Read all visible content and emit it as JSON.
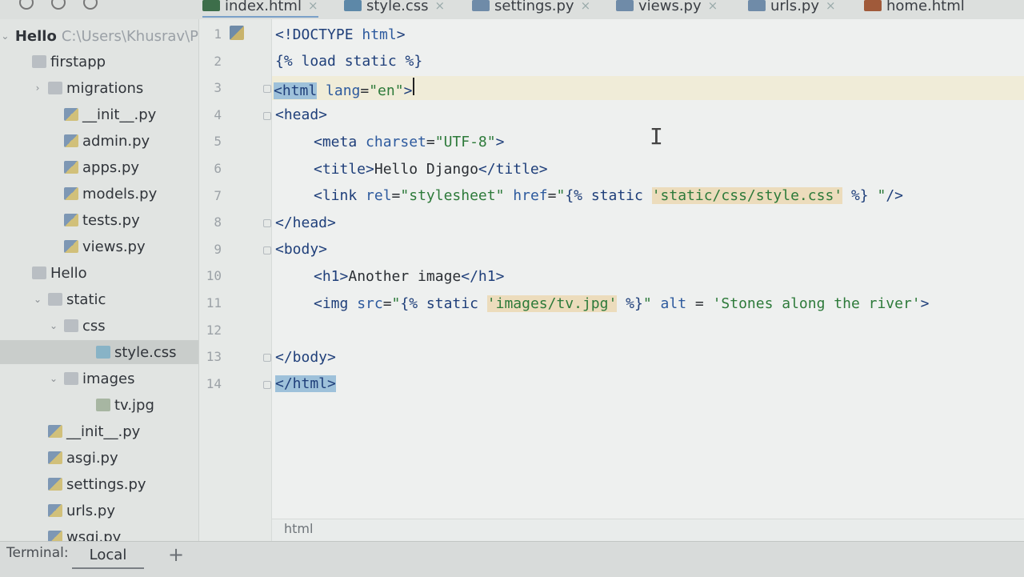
{
  "tabs": [
    {
      "label": "index.html",
      "icon": "html-file-icon",
      "color": "#3d6e4a",
      "active": true
    },
    {
      "label": "style.css",
      "icon": "css-file-icon",
      "color": "#5d88a8",
      "active": false
    },
    {
      "label": "settings.py",
      "icon": "python-file-icon",
      "color": "#6f8ba8",
      "active": false
    },
    {
      "label": "views.py",
      "icon": "python-file-icon",
      "color": "#6f8ba8",
      "active": false
    },
    {
      "label": "urls.py",
      "icon": "python-file-icon",
      "color": "#6f8ba8",
      "active": false
    },
    {
      "label": "home.html",
      "icon": "html-file-icon",
      "color": "#a05a3a",
      "active": false
    }
  ],
  "tab_close_glyph": "×",
  "sidebar": {
    "root": {
      "name": "Hello",
      "path": "C:\\Users\\Khusrav\\P"
    },
    "items": [
      {
        "label": "firstapp",
        "type": "folder",
        "icon": "folder-icon",
        "depth": 1,
        "arrow": ""
      },
      {
        "label": "migrations",
        "type": "folder",
        "icon": "folder-icon",
        "depth": 2,
        "arrow": "›"
      },
      {
        "label": "__init__.py",
        "type": "py",
        "icon": "python-file-icon",
        "depth": 3,
        "arrow": ""
      },
      {
        "label": "admin.py",
        "type": "py",
        "icon": "python-file-icon",
        "depth": 3,
        "arrow": ""
      },
      {
        "label": "apps.py",
        "type": "py",
        "icon": "python-file-icon",
        "depth": 3,
        "arrow": ""
      },
      {
        "label": "models.py",
        "type": "py",
        "icon": "python-file-icon",
        "depth": 3,
        "arrow": ""
      },
      {
        "label": "tests.py",
        "type": "py",
        "icon": "python-file-icon",
        "depth": 3,
        "arrow": ""
      },
      {
        "label": "views.py",
        "type": "py",
        "icon": "python-file-icon",
        "depth": 3,
        "arrow": ""
      },
      {
        "label": "Hello",
        "type": "folder",
        "icon": "folder-icon",
        "depth": 1,
        "arrow": ""
      },
      {
        "label": "static",
        "type": "folder",
        "icon": "folder-icon",
        "depth": 2,
        "arrow": "⌄"
      },
      {
        "label": "css",
        "type": "folder",
        "icon": "folder-icon",
        "depth": 3,
        "arrow": "⌄"
      },
      {
        "label": "style.css",
        "type": "css",
        "icon": "css-file-icon",
        "depth": 5,
        "arrow": "",
        "selected": true
      },
      {
        "label": "images",
        "type": "folder",
        "icon": "folder-icon",
        "depth": 3,
        "arrow": "⌄"
      },
      {
        "label": "tv.jpg",
        "type": "img",
        "icon": "image-file-icon",
        "depth": 5,
        "arrow": ""
      },
      {
        "label": "__init__.py",
        "type": "py",
        "icon": "python-file-icon",
        "depth": 2,
        "arrow": ""
      },
      {
        "label": "asgi.py",
        "type": "py",
        "icon": "python-file-icon",
        "depth": 2,
        "arrow": ""
      },
      {
        "label": "settings.py",
        "type": "py",
        "icon": "python-file-icon",
        "depth": 2,
        "arrow": ""
      },
      {
        "label": "urls.py",
        "type": "py",
        "icon": "python-file-icon",
        "depth": 2,
        "arrow": ""
      },
      {
        "label": "wsgi.py",
        "type": "py",
        "icon": "python-file-icon",
        "depth": 2,
        "arrow": ""
      }
    ]
  },
  "editor": {
    "current_line": 3,
    "lines": [
      {
        "n": "1",
        "indent": 0,
        "tokens": [
          {
            "t": "<!DOCTYPE ",
            "c": "tag"
          },
          {
            "t": "html",
            "c": "attr"
          },
          {
            "t": ">",
            "c": "tag"
          }
        ]
      },
      {
        "n": "2",
        "indent": 0,
        "tokens": [
          {
            "t": "{% load static %}",
            "c": "tpl"
          }
        ]
      },
      {
        "n": "3",
        "indent": 0,
        "tokens": [
          {
            "t": "<html",
            "c": "tag hl-tag"
          },
          {
            "t": " lang",
            "c": "attr"
          },
          {
            "t": "=",
            "c": "plain"
          },
          {
            "t": "\"en\"",
            "c": "str"
          },
          {
            "t": ">",
            "c": "tag"
          }
        ],
        "caret": true
      },
      {
        "n": "4",
        "indent": 0,
        "tokens": [
          {
            "t": "<head>",
            "c": "tag"
          }
        ]
      },
      {
        "n": "5",
        "indent": 1,
        "tokens": [
          {
            "t": "<meta ",
            "c": "tag"
          },
          {
            "t": "charset",
            "c": "attr"
          },
          {
            "t": "=",
            "c": "plain"
          },
          {
            "t": "\"UTF-8\"",
            "c": "str"
          },
          {
            "t": ">",
            "c": "tag"
          }
        ]
      },
      {
        "n": "6",
        "indent": 1,
        "tokens": [
          {
            "t": "<title>",
            "c": "tag"
          },
          {
            "t": "Hello Django",
            "c": "plain"
          },
          {
            "t": "</title>",
            "c": "tag"
          }
        ]
      },
      {
        "n": "7",
        "indent": 1,
        "tokens": [
          {
            "t": "<link ",
            "c": "tag"
          },
          {
            "t": "rel",
            "c": "attr"
          },
          {
            "t": "=",
            "c": "plain"
          },
          {
            "t": "\"stylesheet\" ",
            "c": "str"
          },
          {
            "t": "href",
            "c": "attr"
          },
          {
            "t": "=",
            "c": "plain"
          },
          {
            "t": "\"",
            "c": "str"
          },
          {
            "t": "{% static ",
            "c": "tpl"
          },
          {
            "t": "'static/css/style.css'",
            "c": "tplstr"
          },
          {
            "t": " %}",
            "c": "tpl"
          },
          {
            "t": " \"",
            "c": "str"
          },
          {
            "t": "/>",
            "c": "tag"
          }
        ]
      },
      {
        "n": "8",
        "indent": 0,
        "tokens": [
          {
            "t": "</head>",
            "c": "tag"
          }
        ]
      },
      {
        "n": "9",
        "indent": 0,
        "tokens": [
          {
            "t": "<body>",
            "c": "tag"
          }
        ]
      },
      {
        "n": "10",
        "indent": 1,
        "tokens": [
          {
            "t": "<h1>",
            "c": "tag"
          },
          {
            "t": "Another image",
            "c": "plain"
          },
          {
            "t": "</h1>",
            "c": "tag"
          }
        ]
      },
      {
        "n": "11",
        "indent": 1,
        "tokens": [
          {
            "t": "<img ",
            "c": "tag"
          },
          {
            "t": "src",
            "c": "attr"
          },
          {
            "t": "=",
            "c": "plain"
          },
          {
            "t": "\"",
            "c": "str"
          },
          {
            "t": "{% static ",
            "c": "tpl"
          },
          {
            "t": "'images/tv.jpg'",
            "c": "tplstr"
          },
          {
            "t": " %}",
            "c": "tpl"
          },
          {
            "t": "\" ",
            "c": "str"
          },
          {
            "t": "alt",
            "c": "attr"
          },
          {
            "t": " = ",
            "c": "plain"
          },
          {
            "t": "'Stones along the river'",
            "c": "str"
          },
          {
            "t": ">",
            "c": "tag"
          }
        ]
      },
      {
        "n": "12",
        "indent": 0,
        "tokens": []
      },
      {
        "n": "13",
        "indent": 0,
        "tokens": [
          {
            "t": "</body>",
            "c": "tag"
          }
        ]
      },
      {
        "n": "14",
        "indent": 0,
        "tokens": [
          {
            "t": "</html>",
            "c": "tag hl-tag"
          }
        ]
      }
    ]
  },
  "fold_lines": [
    3,
    4,
    8,
    9,
    13,
    14
  ],
  "breadcrumb": "html",
  "terminal": {
    "label": "Terminal:",
    "tab": "Local",
    "add": "+"
  },
  "colors": {
    "current_line": "#f0ecd8",
    "tag": "#1f3f7a",
    "string": "#2d7a3a",
    "template_highlight": "#ecdcbc",
    "tag_match": "#9ec1da"
  }
}
